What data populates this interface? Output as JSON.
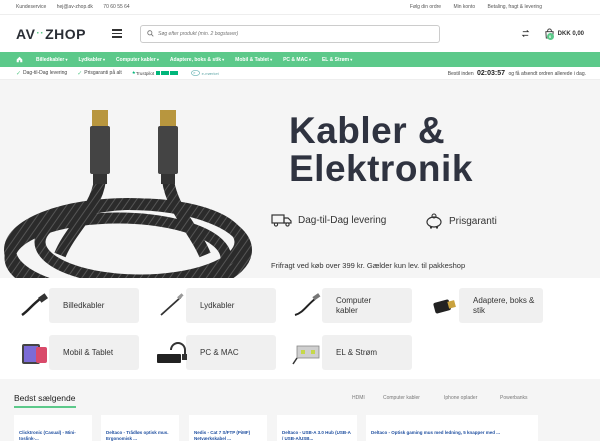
{
  "topbar": {
    "left": [
      "Kundeservice",
      "hej@av-zhop.dk",
      "70 60 55 64"
    ],
    "right": [
      "Følg din ordre",
      "Min konto",
      "Betaling, fragt & levering"
    ]
  },
  "header": {
    "logo_left": "AV",
    "logo_right": "ZHOP",
    "search_placeholder": "Søg efter produkt (min. 2 bogstaver)",
    "cart_total": "DKK 0,00",
    "cart_count": "0"
  },
  "nav": {
    "items": [
      "Billedkabler",
      "Lydkabler",
      "Computer kabler",
      "Adaptere, boks & stik",
      "Mobil & Tablet",
      "PC & MAC",
      "EL & Strøm"
    ]
  },
  "usp": {
    "delivery": "Dag-til-Dag levering",
    "price": "Prisgaranti på alt",
    "trustpilot": "Trustpilot",
    "emaerket": "e-mærket",
    "countdown_prefix": "Bestil inden",
    "countdown_time": "02:03:57",
    "countdown_suffix": "og få afsendt ordren allerede i dag."
  },
  "hero": {
    "title_line1": "Kabler &",
    "title_line2": "Elektronik",
    "feature1": "Dag-til-Dag levering",
    "feature2": "Prisgaranti",
    "note": "Frifragt ved køb over 399 kr.  Gælder kun lev. til pakkeshop"
  },
  "categories": [
    {
      "label": "Billedkabler"
    },
    {
      "label": "Lydkabler"
    },
    {
      "label": "Computer kabler"
    },
    {
      "label": "Adaptere, boks & stik"
    },
    {
      "label": "Mobil & Tablet"
    },
    {
      "label": "PC & MAC"
    },
    {
      "label": "EL & Strøm"
    }
  ],
  "bestsellers": {
    "title": "Bedst sælgende",
    "tabs": [
      "HDMI",
      "Computer kabler",
      "Iphone oplader",
      "Powerbanks"
    ],
    "products": [
      "Clicktronic (Casual) - Mini-toslink-...",
      "Deltaco - Trådløs optisk mus. Ergonomisk ...",
      "Nedis - Cat 7 S/FTP (PiMF) Netværkskabel ...",
      "Deltaco - USB-A 3.0 Hub (USB-A / USB-A/USB...",
      "Deltaco - Optisk gaming mus med ledning, 5 knapper med ..."
    ]
  },
  "colors": {
    "accent": "#5cc98a",
    "nav_text": "#ffffff",
    "heading": "#2f3340",
    "product_link": "#1f4fa0"
  }
}
